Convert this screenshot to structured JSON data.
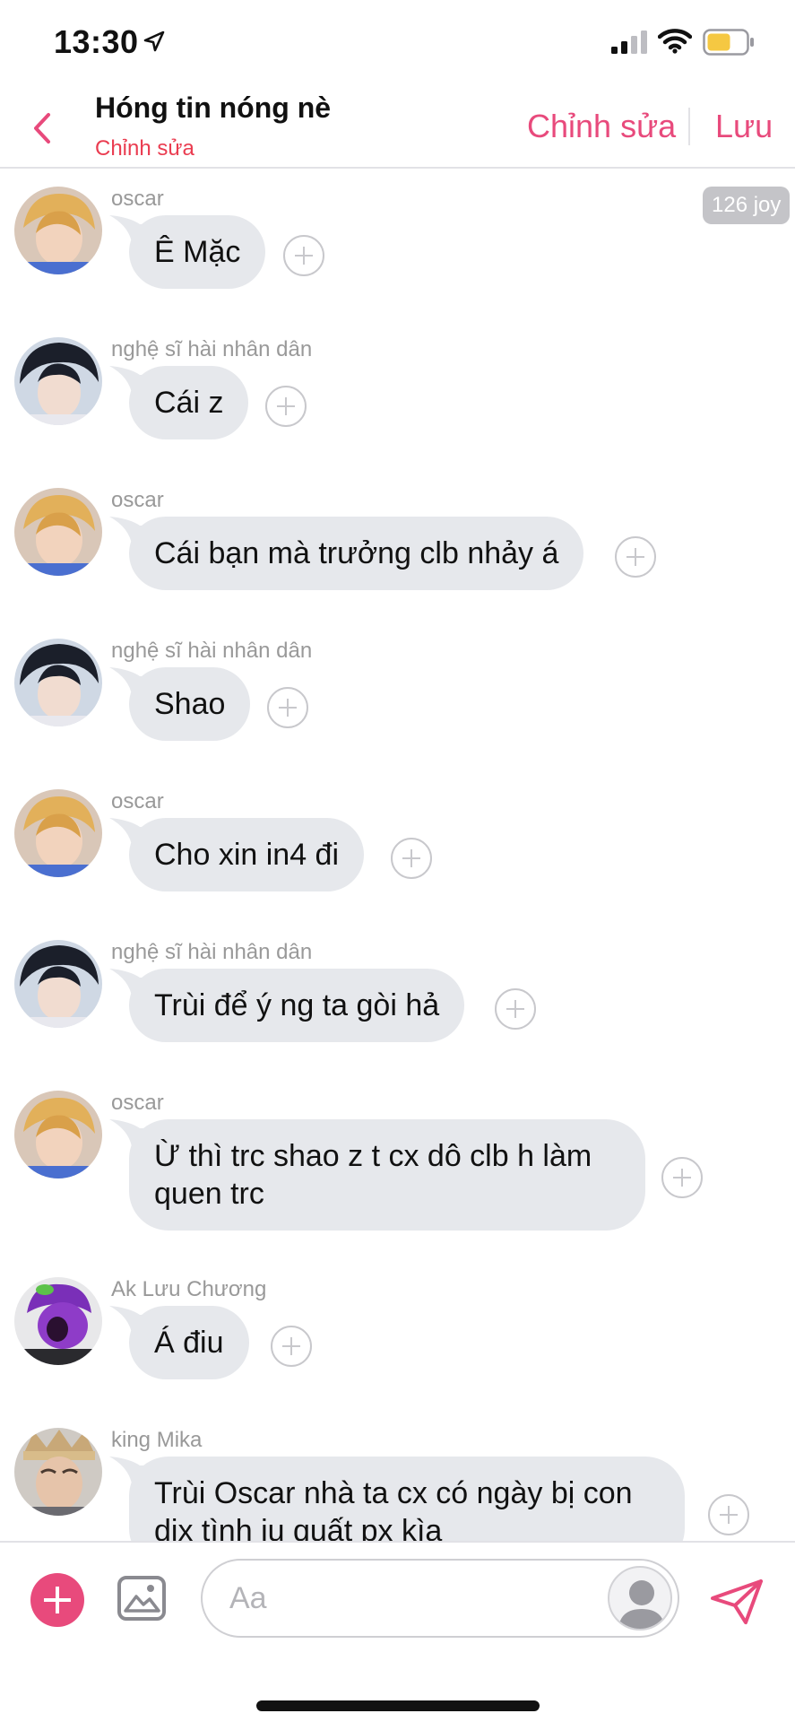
{
  "status_bar": {
    "time": "13:30"
  },
  "header": {
    "title": "Hóng tin nóng nè",
    "subtitle": "Chỉnh sửa",
    "edit_label": "Chỉnh sửa",
    "save_label": "Lưu"
  },
  "joy_badge": "126 joy",
  "messages": [
    {
      "sender": "oscar",
      "text": "Ê Mặc"
    },
    {
      "sender": "nghệ sĩ hài nhân dân",
      "text": "Cái z"
    },
    {
      "sender": "oscar",
      "text": "Cái bạn mà trưởng clb nhảy á"
    },
    {
      "sender": "nghệ sĩ hài nhân dân",
      "text": "Shao"
    },
    {
      "sender": "oscar",
      "text": "Cho xin in4 đi"
    },
    {
      "sender": "nghệ sĩ hài nhân dân",
      "text": "Trùi để ý ng ta gòi hả"
    },
    {
      "sender": "oscar",
      "text": "Ừ thì trc shao z t cx dô clb h làm quen trc"
    },
    {
      "sender": "Ak Lưu Chương",
      "text": "Á điu"
    },
    {
      "sender": "king Mika",
      "text": "Trùi Oscar nhà ta cx có ngày bị con dix tình iu quất px kìa"
    }
  ],
  "input": {
    "placeholder": "Aa"
  },
  "colors": {
    "accent": "#e84a7c",
    "subtitle_red": "#ea3c50",
    "bubble": "#e6e8ec",
    "badge": "#c4c4c8"
  }
}
